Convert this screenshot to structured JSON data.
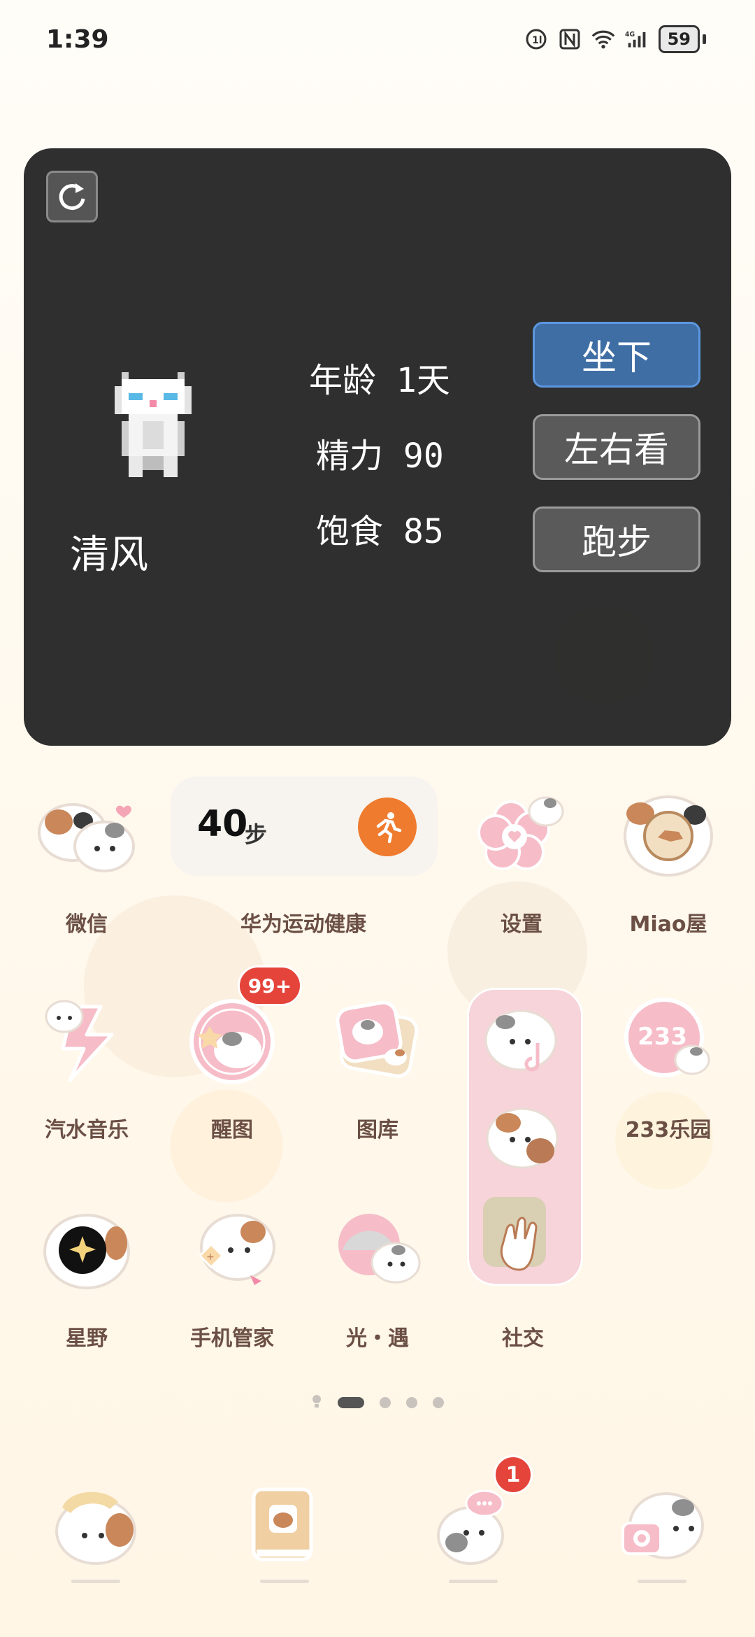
{
  "status_bar": {
    "time": "1:39",
    "battery_level": "59",
    "icons": [
      "volte-icon",
      "nfc-icon",
      "wifi-icon",
      "4g-signal-icon",
      "battery-icon"
    ]
  },
  "pet_widget": {
    "pet_name": "清风",
    "age_label": "年龄",
    "age_value": "1天",
    "energy_label": "精力",
    "energy_value": "90",
    "fullness_label": "饱食",
    "fullness_value": "85",
    "buttons": [
      "坐下",
      "左右看",
      "跑步"
    ],
    "active_button": "坐下"
  },
  "steps_widget": {
    "steps": "40",
    "unit": "步"
  },
  "apps": {
    "wechat": "微信",
    "huawei_health": "华为运动健康",
    "settings": "设置",
    "miao": "Miao屋",
    "qishui_music": "汽水音乐",
    "xingtu": "醒图",
    "gallery": "图库",
    "park233": "233乐园",
    "xingye": "星野",
    "phone_manager": "手机管家",
    "sky": "光・遇",
    "social": "社交"
  },
  "badges": {
    "xingtu": "99+",
    "dock_messages": "1"
  },
  "page_indicator": {
    "pages": 5,
    "current": 2
  },
  "colors": {
    "widget_bg": "#282828",
    "active_button": "#3f6ea5",
    "badge": "#e5443a",
    "run_button": "#ef7b2f",
    "label": "#6b4f45"
  }
}
